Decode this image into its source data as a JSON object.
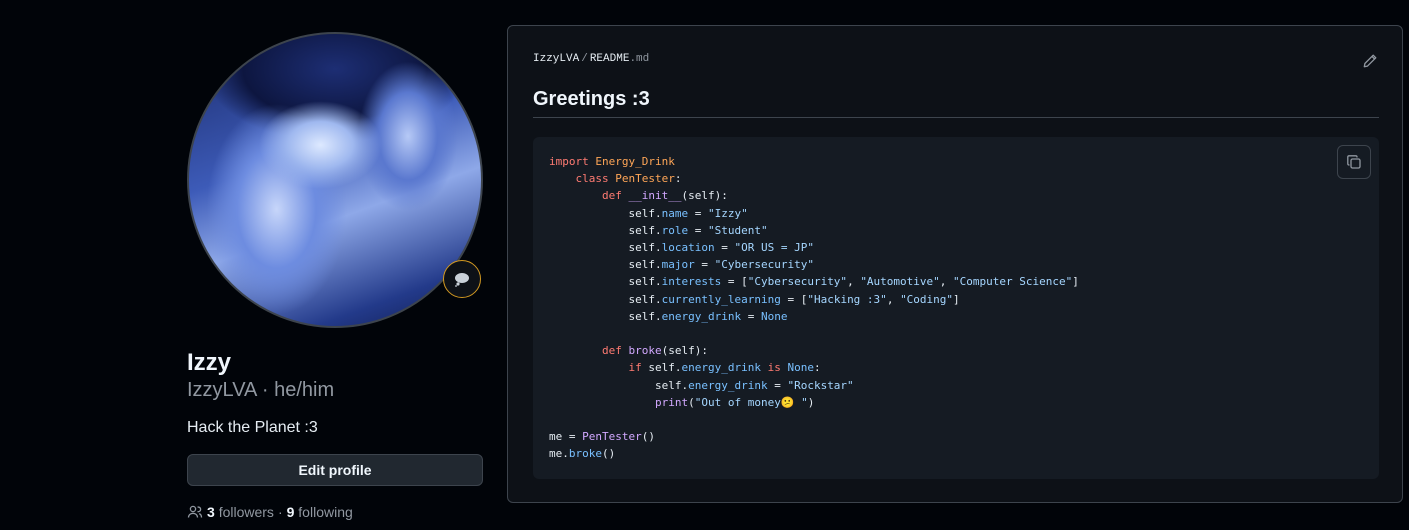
{
  "profile": {
    "name": "Izzy",
    "login": "IzzyLVA",
    "pronouns": "he/him",
    "bio": "Hack the Planet :3",
    "edit_label": "Edit profile",
    "followers_count": "3",
    "followers_label": "followers",
    "following_count": "9",
    "following_label": "following",
    "status_icon": "thought-bubble-icon"
  },
  "readme": {
    "owner": "IzzyLVA",
    "sep": "/",
    "file_base": "README",
    "file_ext": ".md",
    "heading": "Greetings :3",
    "code": {
      "import_kw": "import",
      "module": "Energy_Drink",
      "class_kw": "class",
      "class_name": "PenTester",
      "def_kw": "def",
      "init": "__init__",
      "self_arg": "(self):",
      "self": "self.",
      "attr_name": "name",
      "val_name": "\"Izzy\"",
      "attr_role": "role",
      "val_role": "\"Student\"",
      "attr_location": "location",
      "val_location": "\"OR US = JP\"",
      "attr_major": "major",
      "val_major": "\"Cybersecurity\"",
      "attr_interests": "interests",
      "val_interests_1": "\"Cybersecurity\"",
      "val_interests_2": "\"Automotive\"",
      "val_interests_3": "\"Computer Science\"",
      "attr_learning": "currently_learning",
      "val_learning_1": "\"Hacking :3\"",
      "val_learning_2": "\"Coding\"",
      "attr_drink": "energy_drink",
      "none": "None",
      "broke": "broke",
      "if_kw": "if",
      "is_kw": "is",
      "val_drink": "\"Rockstar\"",
      "print_fn": "print",
      "val_print": "\"Out of money😕 \"",
      "me": "me",
      "call": "PenTester",
      "me_broke": "broke"
    }
  }
}
